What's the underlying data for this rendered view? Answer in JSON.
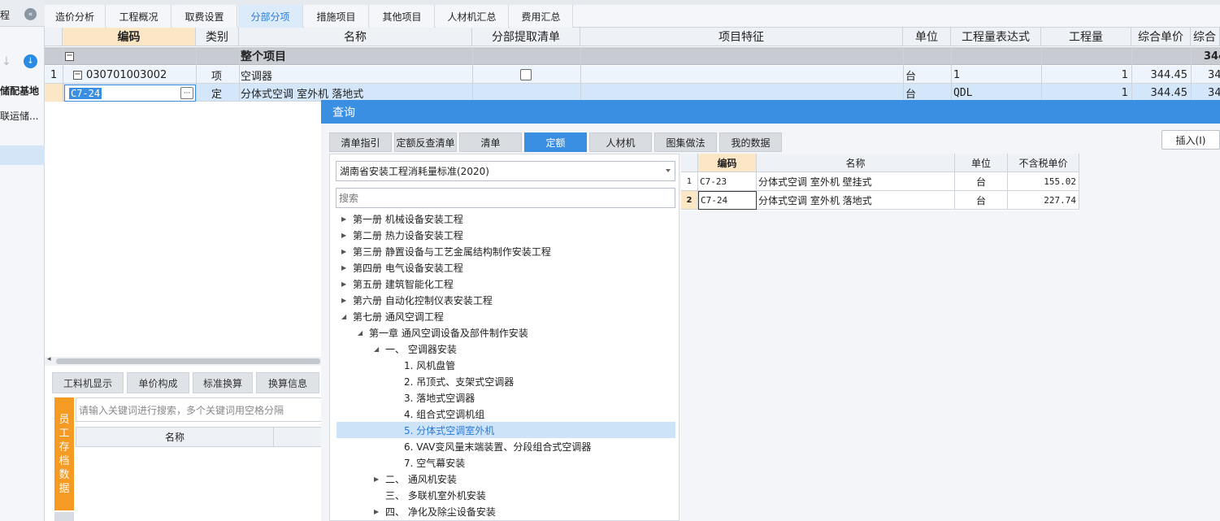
{
  "left_panel": {
    "cfg_label": "程",
    "item1": "储配基地",
    "item2": "联运储..."
  },
  "main_tabs": [
    {
      "label": "造价分析"
    },
    {
      "label": "工程概况"
    },
    {
      "label": "取费设置"
    },
    {
      "label": "分部分项",
      "active": true
    },
    {
      "label": "措施项目"
    },
    {
      "label": "其他项目"
    },
    {
      "label": "人材机汇总"
    },
    {
      "label": "费用汇总"
    }
  ],
  "grid": {
    "headers": [
      "编码",
      "类别",
      "名称",
      "分部提取清单",
      "项目特征",
      "单位",
      "工程量表达式",
      "工程量",
      "综合单价",
      "综合"
    ],
    "total_row": {
      "name": "整个项目",
      "amount": "344"
    },
    "row1": {
      "index": "1",
      "code": "030701003002",
      "type": "项",
      "name": "空调器",
      "unit": "台",
      "expr": "1",
      "qty": "1",
      "price": "344.45",
      "total": "34"
    },
    "row2": {
      "code": "C7-24",
      "type": "定",
      "name": "分体式空调 室外机 落地式",
      "unit": "台",
      "expr": "QDL",
      "qty": "1",
      "price": "344.45",
      "total": "34"
    }
  },
  "bottom_panel": {
    "tabs": [
      "工料机显示",
      "单价构成",
      "标准换算",
      "换算信息"
    ],
    "vertical_tab": [
      "员",
      "工",
      "存",
      "档",
      "数",
      "据"
    ],
    "search_placeholder": "请输入关键词进行搜索，多个关键词用空格分隔",
    "name_header": "名称"
  },
  "query_dialog": {
    "title": "查询",
    "tabs": [
      {
        "label": "清单指引"
      },
      {
        "label": "定额反查清单"
      },
      {
        "label": "清单"
      },
      {
        "label": "定额",
        "active": true
      },
      {
        "label": "人材机"
      },
      {
        "label": "图集做法"
      },
      {
        "label": "我的数据"
      }
    ],
    "insert_button": "插入(I)",
    "standard": "湖南省安装工程消耗量标准(2020)",
    "search_placeholder": "搜索",
    "tree": [
      {
        "label": "第一册 机械设备安装工程"
      },
      {
        "label": "第二册 热力设备安装工程"
      },
      {
        "label": "第三册 静置设备与工艺金属结构制作安装工程"
      },
      {
        "label": "第四册 电气设备安装工程"
      },
      {
        "label": "第五册 建筑智能化工程"
      },
      {
        "label": "第六册 自动化控制仪表安装工程"
      },
      {
        "label": "第七册 通风空调工程"
      },
      {
        "label": "第一章 通风空调设备及部件制作安装"
      },
      {
        "label": "一、 空调器安装"
      },
      {
        "label": "1. 风机盘管"
      },
      {
        "label": "2. 吊顶式、支架式空调器"
      },
      {
        "label": "3. 落地式空调器"
      },
      {
        "label": "4. 组合式空调机组"
      },
      {
        "label": "5. 分体式空调室外机"
      },
      {
        "label": "6. VAV变风量末端装置、分段组合式空调器"
      },
      {
        "label": "7. 空气幕安装"
      },
      {
        "label": "二、 通风机安装"
      },
      {
        "label": "三、 多联机室外机安装"
      },
      {
        "label": "四、 净化及除尘设备安装"
      }
    ],
    "result_headers": [
      "编码",
      "名称",
      "单位",
      "不含税单价"
    ],
    "results": [
      {
        "index": "1",
        "code": "C7-23",
        "name": "分体式空调 室外机 壁挂式",
        "unit": "台",
        "price": "155.02"
      },
      {
        "index": "2",
        "code": "C7-24",
        "name": "分体式空调 室外机 落地式",
        "unit": "台",
        "price": "227.74"
      }
    ]
  },
  "colors": {
    "accent": "#3b8fe3",
    "code_header": "#fbe6c6",
    "vertical_tab": "#f59a23"
  }
}
